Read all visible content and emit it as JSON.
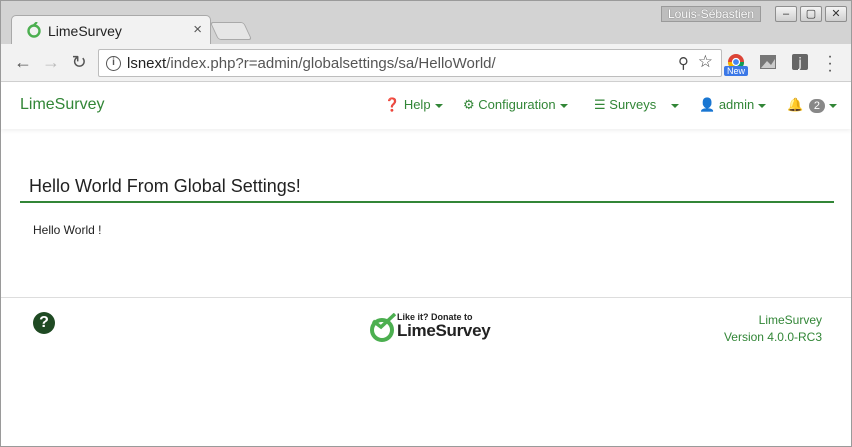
{
  "browser": {
    "tab_title": "LimeSurvey",
    "tab_close": "×",
    "user_name": "Louis-Sébastien",
    "window_buttons": [
      "‒",
      "▢",
      "✕"
    ],
    "url_host": "lsnext",
    "url_path": "/index.php?r=admin/globalsettings/sa/HelloWorld/",
    "extension_badge": "New"
  },
  "app": {
    "brand": "LimeSurvey",
    "nav": {
      "help": "Help",
      "configuration": "Configuration",
      "surveys": "Surveys",
      "admin": "admin",
      "notifications_count": "2"
    }
  },
  "panel": {
    "title": "Hello World From Global Settings!",
    "body": "Hello World !"
  },
  "footer": {
    "donate_small": "Like it? Donate to",
    "donate_big": "LimeSurvey",
    "brand": "LimeSurvey",
    "version": "Version 4.0.0-RC3"
  },
  "colors": {
    "accent": "#328637",
    "rule": "#328637"
  }
}
